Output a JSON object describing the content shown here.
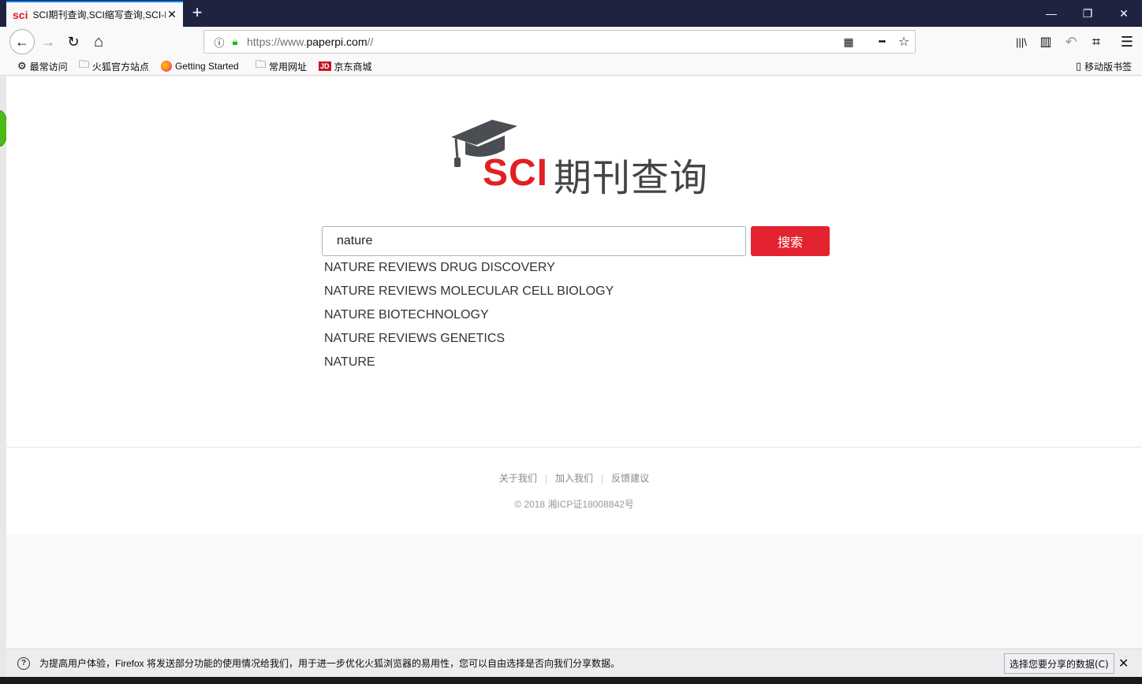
{
  "browser": {
    "tab": {
      "favicon_text": "sci",
      "title": "SCI期刊查询,SCI缩写查询,SCI-I",
      "close": "✕"
    },
    "new_tab": "+",
    "window_controls": {
      "minimize": "—",
      "restore": "❐",
      "close": "✕"
    },
    "nav": {
      "back": "←",
      "forward": "→",
      "reload": "↻",
      "home": "⌂"
    },
    "url": {
      "prefix": "https://www.",
      "domain": "paperpi.com",
      "suffix": "//"
    },
    "url_icons": {
      "qr": "▦",
      "more": "•••",
      "star": "☆"
    },
    "toolbar_icons": {
      "library": "|||\\",
      "sidebar": "▥",
      "undo": "↶",
      "screenshot": "⌗",
      "menu": "☰"
    },
    "bookmarks": [
      {
        "icon": "⚙",
        "label": "最常访问"
      },
      {
        "icon": "🗀",
        "label": "火狐官方站点"
      },
      {
        "icon": "firefox",
        "label": "Getting Started"
      },
      {
        "icon": "🗀",
        "label": "常用网址"
      },
      {
        "icon": "JD",
        "label": "京东商城"
      }
    ],
    "mobile_bookmarks": {
      "icon": "▯",
      "label": "移动版书签"
    }
  },
  "page": {
    "logo": {
      "sci": "SCI",
      "cn": "期刊查询"
    },
    "search": {
      "value": "nature",
      "button": "搜索"
    },
    "suggestions": [
      "NATURE REVIEWS DRUG DISCOVERY",
      "NATURE REVIEWS MOLECULAR CELL BIOLOGY",
      "NATURE BIOTECHNOLOGY",
      "NATURE REVIEWS GENETICS",
      "NATURE"
    ],
    "footer": {
      "links": [
        "关于我们",
        "加入我们",
        "反馈建议"
      ],
      "copyright": "© 2018 湘ICP证18008842号"
    }
  },
  "notification": {
    "icon": "?",
    "text": "为提高用户体验，Firefox 将发送部分功能的使用情况给我们，用于进一步优化火狐浏览器的易用性，您可以自由选择是否向我们分享数据。",
    "button": "选择您要分享的数据(C)",
    "close": "✕"
  },
  "colors": {
    "accent_red": "#e3232f",
    "logo_red": "#e31e24",
    "titlebar": "#202340",
    "tab_highlight": "#0a84ff"
  }
}
